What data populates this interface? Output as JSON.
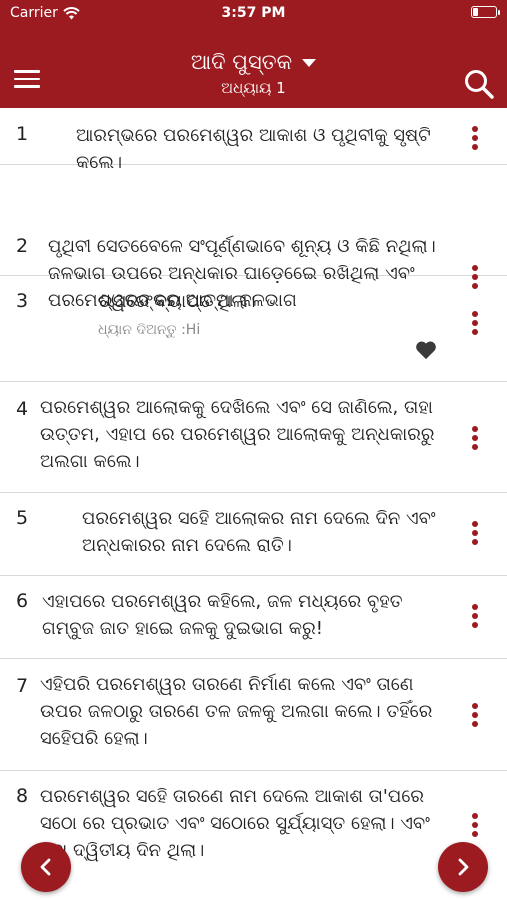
{
  "status_bar": {
    "carrier": "Carrier",
    "time": "3:57 PM",
    "battery_level": 0.25
  },
  "header": {
    "book_title": "ଆଦି ପୁସ୍ତକ",
    "chapter_label": "ଅଧ୍ୟାୟ 1"
  },
  "verses": [
    {
      "number": "1",
      "text": "ଆରମ୍ଭରେ ପରମେଶ୍ୱର ଆକାଶ ଓ ପୃଥିବୀକୁ ସୃଷ୍ଟି କଲେ।"
    },
    {
      "number": "2",
      "text": "ପୃଥିବୀ ସେତବେେଳେ ସଂପୂର୍ଣ୍ଣଭାବେ ଶୂନ୍ୟ ଓ କିଛି ନଥିଲା। ଜଳଭାଗ ଉପରେ ଅନ୍ଧକାର ଘାଡ଼େଇେେ ରଖିଥିଲା ଏବଂ ପରମେଶ୍ୱରଙ୍କର ଆତ୍ମା ଜଳଭାଗ"
    },
    {
      "number": "3",
      "text": "ଉପରେ ବ୍ୟାପ୍ତ ଥିଲା।",
      "note": "ଧ୍ୟାନ ଦିଅନ୍ତୁ :Hi",
      "favorite": true
    },
    {
      "number": "4",
      "text": "ପରମେଶ୍ୱର ଆଲୋକକୁ ଦେଖିଲେ ଏବଂ ସେ ଜାଣିଲେ, ତାହା ଉତ୍ତମ, ଏହାପ ରେ ପରମେଶ୍ୱର ଆଲୋକକୁ ଅନ୍ଧକାରରୁ ଅଲଗା କଲେ।"
    },
    {
      "number": "5",
      "text": "ପରମେଶ୍ୱର ସହେି ଆଲୋକର ନାମ ଦେଲେ  ଦିନ ଏବଂ ଅନ୍ଧକାରର ନାମ ଦେଲେ ରାତି।"
    },
    {
      "number": "6",
      "text": "ଏହାପରେ ପରମେଶ୍ୱର କହିଲେ, ଜଳ ମଧ୍ୟରେ ବୃହତ ଗମ୍ବୁଜ ଜାତ ହାଇେ ଜଳକୁ ଦୁଇଭାଗ କରୁ!"
    },
    {
      "number": "7",
      "text": "ଏହିପରି ପରମେଶ୍ୱର ତାରଣେ ନିର୍ମାଣ କଲେ ଏବଂ ତାଣେ ଉପର ଜଳଠାରୁ ତାରଣେ ତଳ ଜଳକୁ ଅଲଗା କଲେ। ତହିଁରେ ସହେିପରି ହେଲା।"
    },
    {
      "number": "8",
      "text": "ପରମେଶ୍ୱର ସହେି ତାରଣେ ନାମ ଦେଲେ ଆକାଶ ତା'ପରେ ସଠୋ ରେ ପ୍ରଭାତ ଏବଂ ସଠୋରେ ସୁର୍ଯ୍ୟାସ୍ତ ହେଲା। ଏବଂ ଏହା ଦ୍ୱିତୀୟ ଦିନ ଥିଲା।"
    }
  ],
  "colors": {
    "primary": "#9c1b21",
    "divider": "#d8d8d8"
  }
}
